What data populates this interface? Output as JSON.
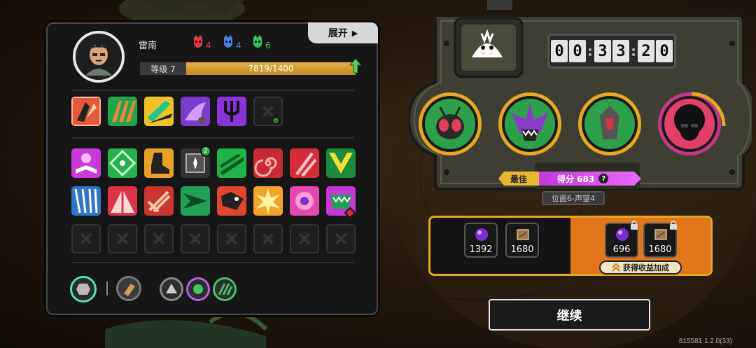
{
  "hero": {
    "name": "雷南",
    "level_label": "等级 7",
    "xp_text": "7819/1400",
    "xp_progress": 1.0
  },
  "stats": [
    {
      "icon": "red-mask-icon",
      "color": "#e23b3b",
      "value": "4"
    },
    {
      "icon": "blue-mask-icon",
      "color": "#4a7fe8",
      "value": "4"
    },
    {
      "icon": "green-mask-icon",
      "color": "#38c25a",
      "value": "6"
    }
  ],
  "expand_button": {
    "label": "展开",
    "arrow": "▶"
  },
  "timer": {
    "digits": [
      "0",
      "0",
      "3",
      "3",
      "2",
      "0"
    ]
  },
  "score": {
    "best_label": "最佳",
    "score_text": "得分 683",
    "help": "?"
  },
  "stage": "位面6-声望4",
  "rewards": [
    {
      "name": "purple-orb-reward",
      "value": "1392"
    },
    {
      "name": "card-reward",
      "value": "1680"
    },
    {
      "name": "purple-orb-bonus-reward",
      "value": "696",
      "locked": true
    },
    {
      "name": "card-bonus-reward",
      "value": "1680",
      "locked": true
    }
  ],
  "bonus_button": {
    "label": "获得收益加成"
  },
  "continue_button": {
    "label": "继续"
  },
  "version": "815581 1.2.0(33)",
  "badges": {
    "upgrade_count": "2"
  },
  "colors": {
    "accent_gold": "#e4a726",
    "score_purple": "#d456ee",
    "bonus_orange": "#e1761a"
  }
}
